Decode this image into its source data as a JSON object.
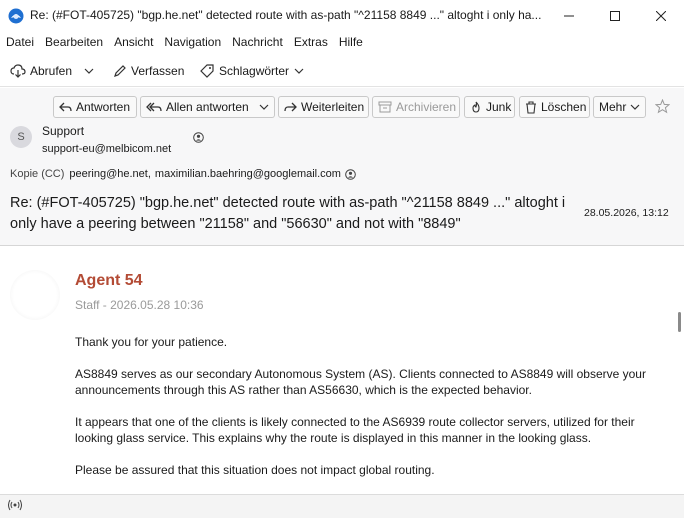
{
  "window": {
    "title": "Re: (#FOT-405725) \"bgp.he.net\" detected route with as-path \"^21158 8849 ...\" altoght i only ha...",
    "app_icon": "thunderbird-icon"
  },
  "menu": [
    "Datei",
    "Bearbeiten",
    "Ansicht",
    "Navigation",
    "Nachricht",
    "Extras",
    "Hilfe"
  ],
  "toolbar": {
    "get_mail": "Abrufen",
    "compose": "Verfassen",
    "tags": "Schlagwörter"
  },
  "header_actions": {
    "reply": "Antworten",
    "reply_all": "Allen antworten",
    "forward": "Weiterleiten",
    "archive": "Archivieren",
    "junk": "Junk",
    "delete": "Löschen",
    "more": "Mehr"
  },
  "sender": {
    "avatar_letter": "S",
    "name": "Support",
    "email": "support-eu@melbicom.net"
  },
  "cc": {
    "label": "Kopie (CC)",
    "recipients": [
      "peering@he.net",
      "maximilian.baehring@googlemail.com"
    ],
    "separator": ","
  },
  "subject": "Re: (#FOT-405725) \"bgp.he.net\" detected route with as-path \"^21158 8849 ...\" altoght i only have a peering between \"21158\" and \"56630\" and not with \"8849\"",
  "date": "28.05.2026, 13:12",
  "message": {
    "agent_name": "Agent 54",
    "agent_meta": "Staff - 2026.05.28 10:36",
    "paragraphs": [
      "Thank you for your patience.",
      "AS8849 serves as our secondary Autonomous System (AS). Clients connected to AS8849 will observe your announcements through this AS rather than AS56630, which is the expected behavior.",
      "It appears that one of the clients is likely connected to the AS6939 route collector servers, utilized for their looking glass service. This explains why the route is displayed in this manner in the looking glass.",
      "Please be assured that this situation does not impact global routing."
    ]
  },
  "colors": {
    "agent_name": "#b34b35",
    "header_bg": "#f7f7f8"
  }
}
